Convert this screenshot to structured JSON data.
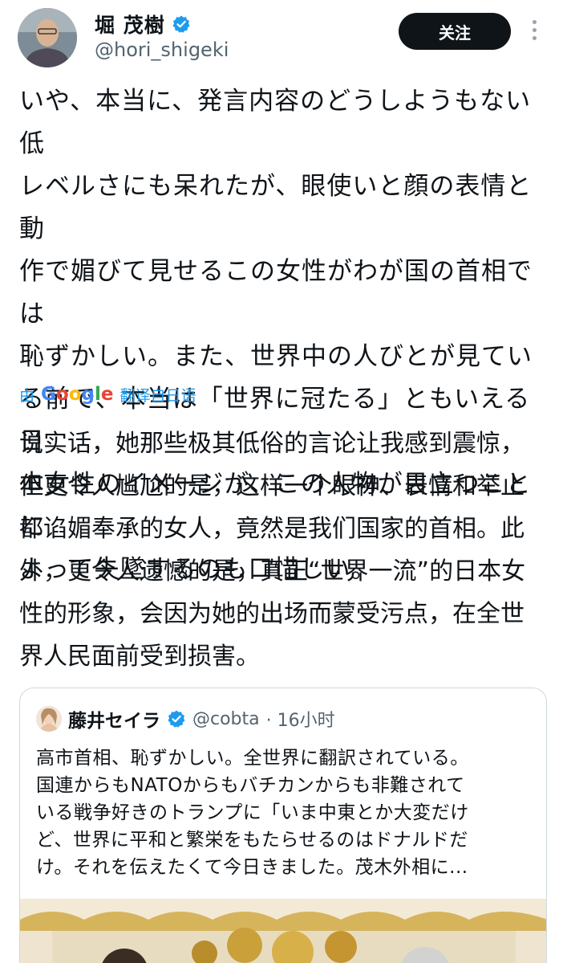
{
  "author": {
    "display_name": "堀 茂樹",
    "handle": "@hori_shigeki",
    "verified": true
  },
  "actions": {
    "follow_label": "关注",
    "more_icon": "more-vertical-icon"
  },
  "tweet": {
    "text": "いや、本当に、発言内容のどうしようもない低\nレベルさにも呆れたが、眼使いと顔の表情と動\n作で媚びて見せるこの女性がわが国の首相では\n恥ずかしい。また、世界中の人びとが見てい\nる前で、本当は「世界に冠たる」ともいえる日\n本女性のイメージが、この人物が目立つことに\nよって失墜するのも口惜しい。"
  },
  "translation": {
    "prefix": "由",
    "provider": "Google",
    "suffix": "翻译自日语",
    "text": "说实话，她那些极其低俗的言论让我感到震惊，\n但更令人尴尬的是，这样一个眼神、表情和举止\n都谄媚奉承的女人，竟然是我们国家的首相。此\n外，更令人遗憾的是，真正“世界一流”的日本女\n性的形象，会因为她的出场而蒙受污点，在全世\n界人民面前受到损害。"
  },
  "quoted_tweet": {
    "display_name": "藤井セイラ",
    "handle": "@cobta",
    "time": "· 16小时",
    "verified": true,
    "text": "高市首相、恥ずかしい。全世界に翻訳されている。\n国連からもNATOからもバチカンからも非難されて\nいる戦争好きのトランプに「いま中東とか大変だけ\nど、世界に平和と繁栄をもたらせるのはドナルドだ\nけ。それを伝えたくて今日きました。茂木外相に..."
  },
  "colors": {
    "text": "#0f1419",
    "secondary": "#536471",
    "link": "#1d9bf0",
    "verified": "#1d9bf0",
    "button_bg": "#0f1419",
    "border": "#cfd9de"
  }
}
